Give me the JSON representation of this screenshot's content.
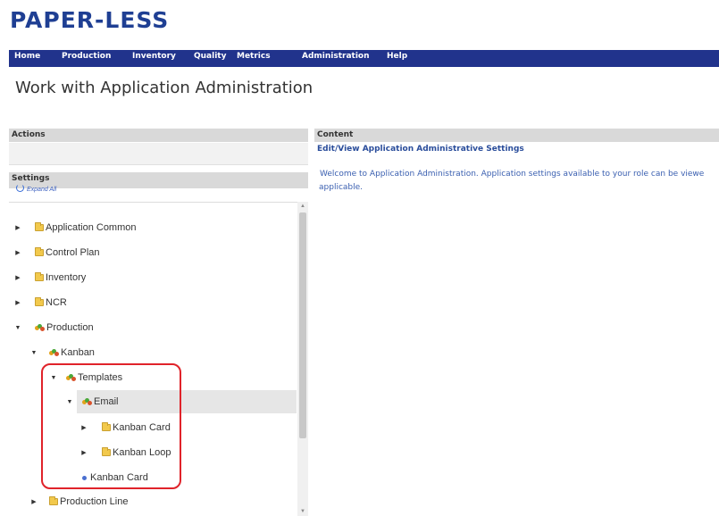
{
  "app": {
    "logo": "PAPER-LESS"
  },
  "nav": {
    "items": [
      "Home",
      "Production",
      "Inventory",
      "Quality",
      "Metrics",
      "Administration",
      "Help"
    ]
  },
  "page": {
    "title": "Work with Application Administration"
  },
  "actions": {
    "header": "Actions"
  },
  "settings": {
    "header": "Settings",
    "expand_all": "Expand All",
    "tree": [
      {
        "label": "Application Common",
        "icon": "folder-icon",
        "expanded": false
      },
      {
        "label": "Control Plan",
        "icon": "folder-icon",
        "expanded": false
      },
      {
        "label": "Inventory",
        "icon": "folder-icon",
        "expanded": false
      },
      {
        "label": "NCR",
        "icon": "folder-icon",
        "expanded": false
      },
      {
        "label": "Production",
        "icon": "settings-group-icon",
        "expanded": true
      },
      {
        "label": "Kanban",
        "icon": "settings-group-icon",
        "expanded": true
      },
      {
        "label": "Templates",
        "icon": "settings-group-icon",
        "expanded": true
      },
      {
        "label": "Email",
        "icon": "settings-group-icon",
        "expanded": true,
        "selected": true
      },
      {
        "label": "Kanban Card",
        "icon": "folder-icon",
        "expanded": false
      },
      {
        "label": "Kanban Loop",
        "icon": "folder-icon",
        "expanded": false
      },
      {
        "label": "Kanban Card",
        "icon": "bullet-icon"
      },
      {
        "label": "Production Line",
        "icon": "folder-icon",
        "expanded": false
      }
    ]
  },
  "content": {
    "header": "Content",
    "link": "Edit/View Application Administrative Settings",
    "text_line1": "Welcome to Application Administration. Application settings available to your role can be viewe",
    "text_line2": "applicable."
  },
  "colors": {
    "brand": "#1f3f93",
    "nav_bg": "#21338c",
    "highlight": "#e0232a",
    "folder": "#f2c94c"
  }
}
